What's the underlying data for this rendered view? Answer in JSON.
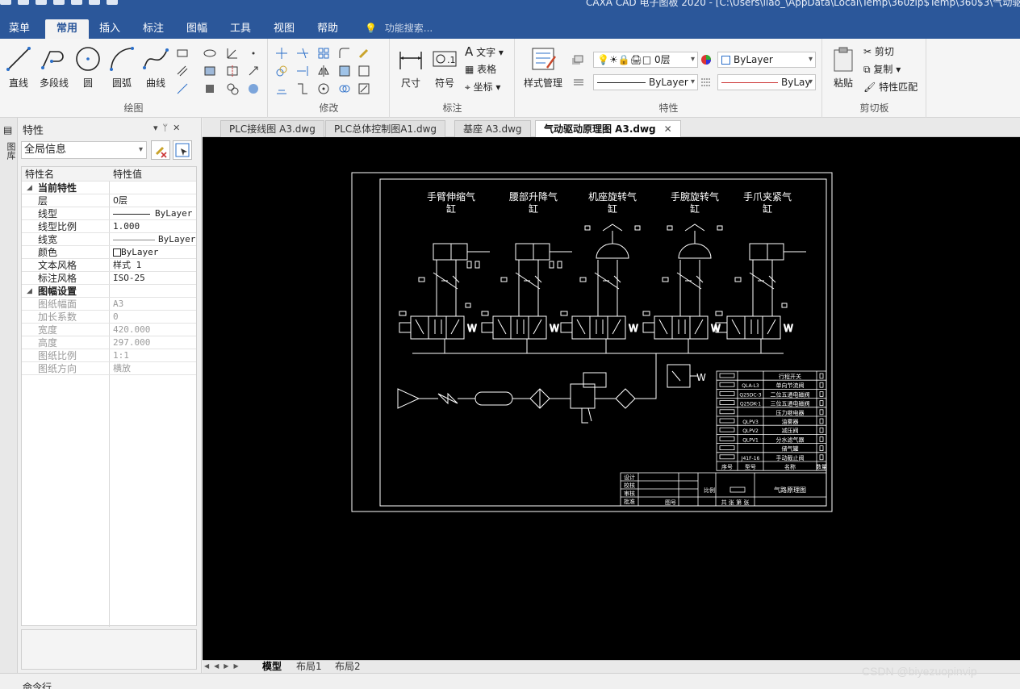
{
  "window": {
    "title": "CAXA CAD 电子图板 2020 - [C:\\Users\\liao_\\AppData\\Local\\Temp\\360zip$Temp\\360$3\\气动驱动原理图"
  },
  "menu": {
    "tabs": [
      "菜单",
      "常用",
      "插入",
      "标注",
      "图幅",
      "工具",
      "视图",
      "帮助"
    ],
    "active": "常用",
    "search_placeholder": "功能搜索..."
  },
  "ribbon": {
    "draw": {
      "label": "绘图",
      "tools": [
        "直线",
        "多段线",
        "圆",
        "圆弧",
        "曲线"
      ]
    },
    "modify": {
      "label": "修改"
    },
    "annotate": {
      "label": "标注",
      "tools": [
        "尺寸",
        "符号"
      ],
      "small": [
        "文字",
        "表格",
        "坐标"
      ]
    },
    "properties": {
      "label": "特性",
      "style_btn": "样式管理",
      "layer": "0层",
      "color": "ByLayer",
      "linetype1": "ByLayer",
      "linetype2": "ByLay"
    },
    "clipboard": {
      "label": "剪切板",
      "paste": "粘贴",
      "cut": "剪切",
      "copy": "复制",
      "match": "特性匹配"
    }
  },
  "panel": {
    "title": "特性",
    "side_tab": "图库",
    "selector": "全局信息",
    "headers": {
      "name": "特性名",
      "value": "特性值"
    },
    "current_props_label": "当前特性",
    "props": [
      {
        "k": "层",
        "v": "0层"
      },
      {
        "k": "线型",
        "v": "ByLayer"
      },
      {
        "k": "线型比例",
        "v": "1.000"
      },
      {
        "k": "线宽",
        "v": "ByLayer"
      },
      {
        "k": "颜色",
        "v": "ByLayer"
      },
      {
        "k": "文本风格",
        "v": "样式 1"
      },
      {
        "k": "标注风格",
        "v": "ISO-25"
      }
    ],
    "sheet_label": "图幅设置",
    "sheet": [
      {
        "k": "图纸幅面",
        "v": "A3"
      },
      {
        "k": "加长系数",
        "v": "0"
      },
      {
        "k": "宽度",
        "v": "420.000"
      },
      {
        "k": "高度",
        "v": "297.000"
      },
      {
        "k": "图纸比例",
        "v": "1:1"
      },
      {
        "k": "图纸方向",
        "v": "横放"
      }
    ]
  },
  "doc_tabs": [
    {
      "label": "PLC接线图 A3.dwg"
    },
    {
      "label": "PLC总体控制图A1.dwg"
    },
    {
      "label": "基座 A3.dwg"
    },
    {
      "label": "气动驱动原理图 A3.dwg"
    }
  ],
  "drawing": {
    "cylinder_labels": [
      [
        "手臂伸缩气",
        "缸"
      ],
      [
        "腰部升降气",
        "缸"
      ],
      [
        "机座旋转气",
        "缸"
      ],
      [
        "手腕旋转气",
        "缸"
      ],
      [
        "手爪夹紧气",
        "缸"
      ]
    ],
    "bom_rows": [
      [
        "",
        "",
        "行程开关"
      ],
      [
        "",
        "QLA-L3",
        "单向节流阀"
      ],
      [
        "",
        "Q25DC-3",
        "二位五通电磁阀"
      ],
      [
        "",
        "Q25DK-1",
        "三位五通电磁阀"
      ],
      [
        "",
        "",
        "压力继电器"
      ],
      [
        "",
        "QLPV3",
        "油雾器"
      ],
      [
        "",
        "QLPV2",
        "减压阀"
      ],
      [
        "",
        "QLPV1",
        "分水滤气器"
      ],
      [
        "",
        "",
        "储气罐"
      ],
      [
        "",
        "J41F-16",
        "手动截止阀"
      ]
    ],
    "bom_header": [
      "序号",
      "型号",
      "名称",
      "数量"
    ],
    "title_block": {
      "roles": [
        "设计",
        "校核",
        "审核",
        "批准"
      ],
      "scale_label": "比例",
      "drawing_name": "气路原理图",
      "sheets": "共  张  第  张",
      "part_no": "图号"
    }
  },
  "layout_tabs": [
    "模型",
    "布局1",
    "布局2"
  ],
  "command_label": "命令行",
  "watermark": "CSDN @biyezuopinvip"
}
